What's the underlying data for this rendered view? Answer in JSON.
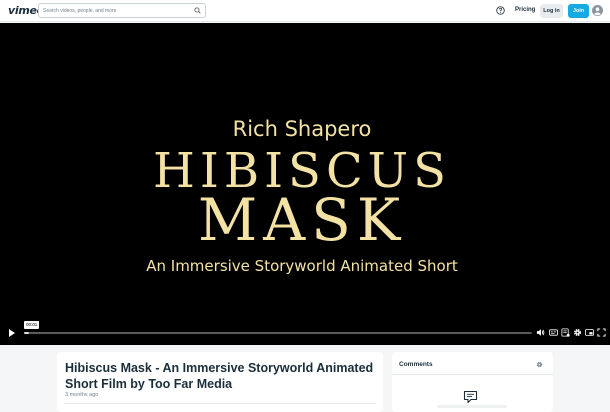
{
  "header": {
    "logo_text": "vimeo",
    "search_placeholder": "Search videos, people, and more",
    "pricing_label": "Pricing",
    "login_label": "Log in",
    "join_label": "Join",
    "icons": {
      "search": "search-icon",
      "help": "help-icon",
      "avatar": "avatar-icon"
    }
  },
  "player": {
    "frame_text": {
      "author": "Rich Shapero",
      "title_line1": "HIBISCUS",
      "title_line2": "MASK",
      "subtitle": "An Immersive Storyworld Animated Short"
    },
    "time_badge": "00:01",
    "progress": 0.01,
    "controls": [
      "play-icon",
      "volume-icon",
      "captions-icon",
      "chapters-icon",
      "settings-icon",
      "pip-icon",
      "fullscreen-icon"
    ]
  },
  "video": {
    "title": "Hibiscus Mask - An Immersive Storyworld Animated Short Film by Too Far Media",
    "age": "3 months ago"
  },
  "comments": {
    "title": "Comments",
    "icons": [
      "gear-icon",
      "comment-bubble-icon"
    ]
  },
  "colors": {
    "accent": "#17a9e1",
    "title_gold": "#f3e2a4",
    "text_dark": "#1a2e3b",
    "page_bg": "#f5f6f7"
  }
}
